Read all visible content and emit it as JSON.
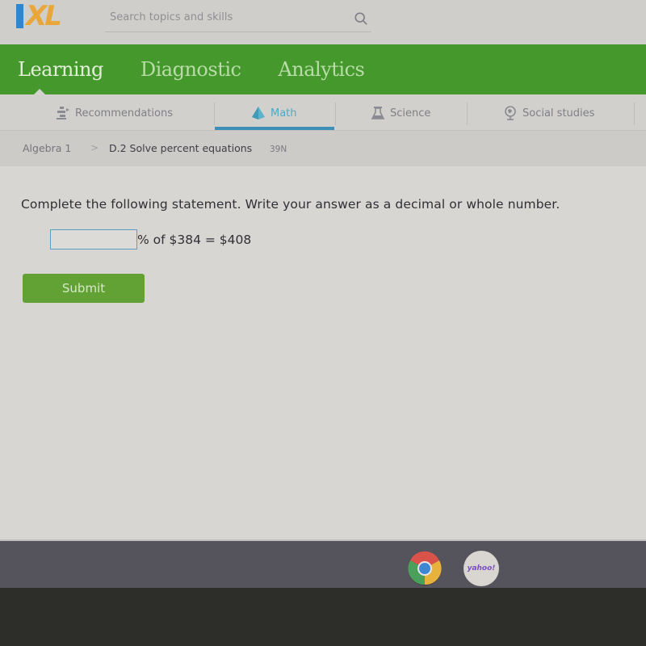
{
  "header": {
    "logo": {
      "i": "I",
      "xl": "XL"
    },
    "search": {
      "placeholder": "Search topics and skills",
      "value": "",
      "icon": "search-icon"
    }
  },
  "main_nav": {
    "tabs": [
      {
        "label": "Learning",
        "active": true
      },
      {
        "label": "Diagnostic",
        "active": false
      },
      {
        "label": "Analytics",
        "active": false
      }
    ]
  },
  "subject_nav": {
    "items": [
      {
        "label": "Recommendations",
        "icon": "recommendations-icon",
        "active": false
      },
      {
        "label": "Math",
        "icon": "math-pyramid-icon",
        "active": true
      },
      {
        "label": "Science",
        "icon": "science-flask-icon",
        "active": false
      },
      {
        "label": "Social studies",
        "icon": "globe-icon",
        "active": false
      }
    ]
  },
  "breadcrumb": {
    "course": "Algebra 1",
    "separator": ">",
    "skill": "D.2 Solve percent equations",
    "skill_code": "39N"
  },
  "question": {
    "instructions": "Complete the following statement. Write your answer as a decimal or whole number.",
    "answer_value": "",
    "equation_suffix": "% of $384 = $408"
  },
  "actions": {
    "submit_label": "Submit"
  },
  "taskbar": {
    "apps": [
      {
        "name": "Chrome",
        "icon": "chrome-icon",
        "running": true
      },
      {
        "name": "Yahoo",
        "label": "yahoo!",
        "icon": "yahoo-icon",
        "running": false
      }
    ]
  },
  "colors": {
    "nav_green": "#44982c",
    "submit_green": "#62a234",
    "logo_blue": "#2f86cf",
    "logo_orange": "#e9a73b",
    "math_active": "#4fa9c4"
  }
}
